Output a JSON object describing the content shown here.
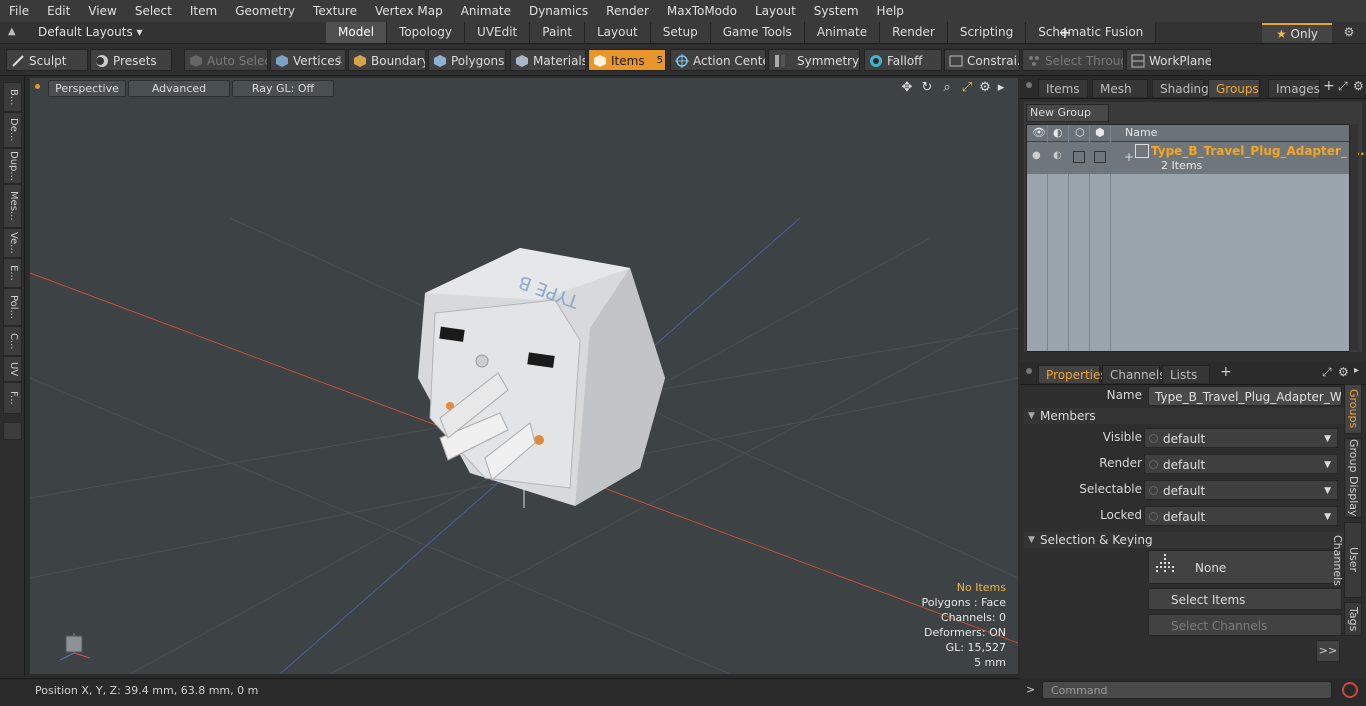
{
  "menu": [
    "File",
    "Edit",
    "View",
    "Select",
    "Item",
    "Geometry",
    "Texture",
    "Vertex Map",
    "Animate",
    "Dynamics",
    "Render",
    "MaxToModo",
    "Layout",
    "System",
    "Help"
  ],
  "layouts_label": "Default Layouts",
  "mode_tabs": [
    {
      "label": "Model",
      "active": true
    },
    {
      "label": "Topology"
    },
    {
      "label": "UVEdit"
    },
    {
      "label": "Paint"
    },
    {
      "label": "Layout"
    },
    {
      "label": "Setup"
    },
    {
      "label": "Game Tools"
    },
    {
      "label": "Animate"
    },
    {
      "label": "Render"
    },
    {
      "label": "Scripting"
    },
    {
      "label": "Schematic Fusion"
    }
  ],
  "add_tab_glyph": "+",
  "only_label": "Only",
  "toolbar": {
    "sculpt": "Sculpt",
    "presets": "Presets",
    "auto_select": "Auto Select",
    "vertices": "Vertices",
    "vertices_count": "1",
    "boundary": "Boundary",
    "polygons": "Polygons",
    "materials": "Materials",
    "items": "Items",
    "items_count": "5",
    "action_center": "Action Center",
    "symmetry": "Symmetry",
    "falloff": "Falloff",
    "constraints": "Constrai...",
    "select_through": "Select Through",
    "workplane": "WorkPlane"
  },
  "left_tabs": [
    "B...",
    "De...",
    "Dup...",
    "Mes...",
    "Ve...",
    "E...",
    "Pol...",
    "C...",
    "UV",
    "F..."
  ],
  "viewport": {
    "perspective": "Perspective",
    "advanced": "Advanced",
    "raygl": "Ray GL: Off",
    "model_label": "TYPE B",
    "overlay": {
      "items": "No Items",
      "polygons": "Polygons : Face",
      "channels": "Channels: 0",
      "deformers": "Deformers: ON",
      "gl": "GL: 15,527",
      "scale": "5 mm"
    }
  },
  "status": {
    "position": "Position X, Y, Z:   39.4 mm, 63.8 mm, 0 m"
  },
  "panel_tabs": [
    "Items",
    "Mesh ...",
    "Shading",
    "Groups",
    "Images"
  ],
  "panel_active": "Groups",
  "groups": {
    "new_group": "New Group",
    "col_name": "Name",
    "item_name": "Type_B_Travel_Plug_Adapter_ ...",
    "item_count": "2 Items"
  },
  "props_tabs": [
    "Properties",
    "Channels",
    "Lists"
  ],
  "props": {
    "name_label": "Name",
    "name_value": "Type_B_Travel_Plug_Adapter_White (",
    "members": "Members",
    "rows": [
      {
        "label": "Visible",
        "value": "default"
      },
      {
        "label": "Render",
        "value": "default"
      },
      {
        "label": "Selectable",
        "value": "default"
      },
      {
        "label": "Locked",
        "value": "default"
      }
    ],
    "selection_keying": "Selection & Keying",
    "none": "None",
    "select_items": "Select Items",
    "select_channels": "Select Channels",
    "more": ">>"
  },
  "right_vtabs": [
    "Groups",
    "Group Display",
    "User Channels",
    "Tags"
  ],
  "command": {
    "prompt": ">",
    "placeholder": "Command"
  },
  "colors": {
    "accent": "#e8952b",
    "selected_text": "#f5a623"
  }
}
